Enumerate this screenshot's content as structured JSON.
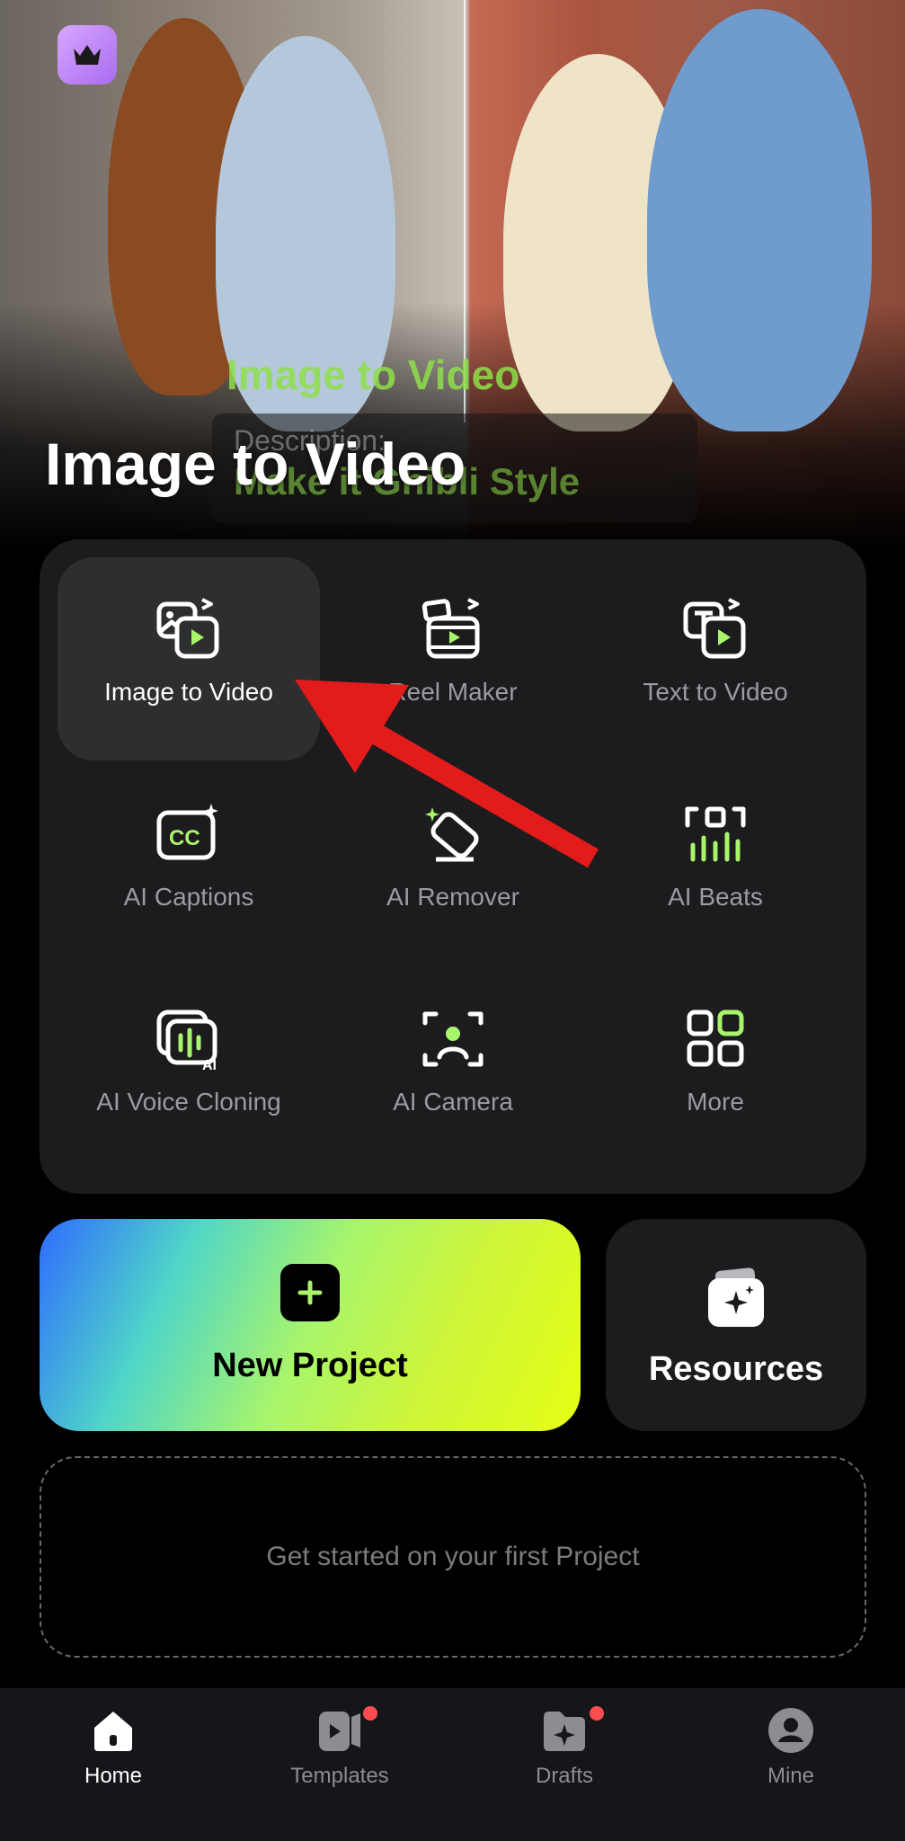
{
  "hero": {
    "title": "Image to Video",
    "overlay_label": "Image to Video",
    "description_label": "Description:",
    "description_text": "Make it Ghibli Style"
  },
  "tools": [
    {
      "label": "Image to Video",
      "icon": "image-to-video-icon",
      "active": true
    },
    {
      "label": "Reel Maker",
      "icon": "reel-maker-icon",
      "active": false
    },
    {
      "label": "Text to Video",
      "icon": "text-to-video-icon",
      "active": false
    },
    {
      "label": "AI Captions",
      "icon": "ai-captions-icon",
      "active": false
    },
    {
      "label": "AI Remover",
      "icon": "ai-remover-icon",
      "active": false
    },
    {
      "label": "AI Beats",
      "icon": "ai-beats-icon",
      "active": false
    },
    {
      "label": "AI Voice Cloning",
      "icon": "ai-voice-cloning-icon",
      "active": false
    },
    {
      "label": "AI Camera",
      "icon": "ai-camera-icon",
      "active": false
    },
    {
      "label": "More",
      "icon": "more-grid-icon",
      "active": false
    }
  ],
  "actions": {
    "new_project_label": "New Project",
    "resources_label": "Resources"
  },
  "empty_state": "Get started on your first Project",
  "nav": [
    {
      "label": "Home",
      "icon": "home-icon",
      "active": true,
      "badge": false
    },
    {
      "label": "Templates",
      "icon": "templates-icon",
      "active": false,
      "badge": true
    },
    {
      "label": "Drafts",
      "icon": "drafts-icon",
      "active": false,
      "badge": true
    },
    {
      "label": "Mine",
      "icon": "profile-icon",
      "active": false,
      "badge": false
    }
  ],
  "colors": {
    "accent_green": "#a8f56b",
    "accent_lime": "#e6ff14",
    "badge_red": "#ff4d4f",
    "annotation_arrow": "#e21b1b"
  }
}
